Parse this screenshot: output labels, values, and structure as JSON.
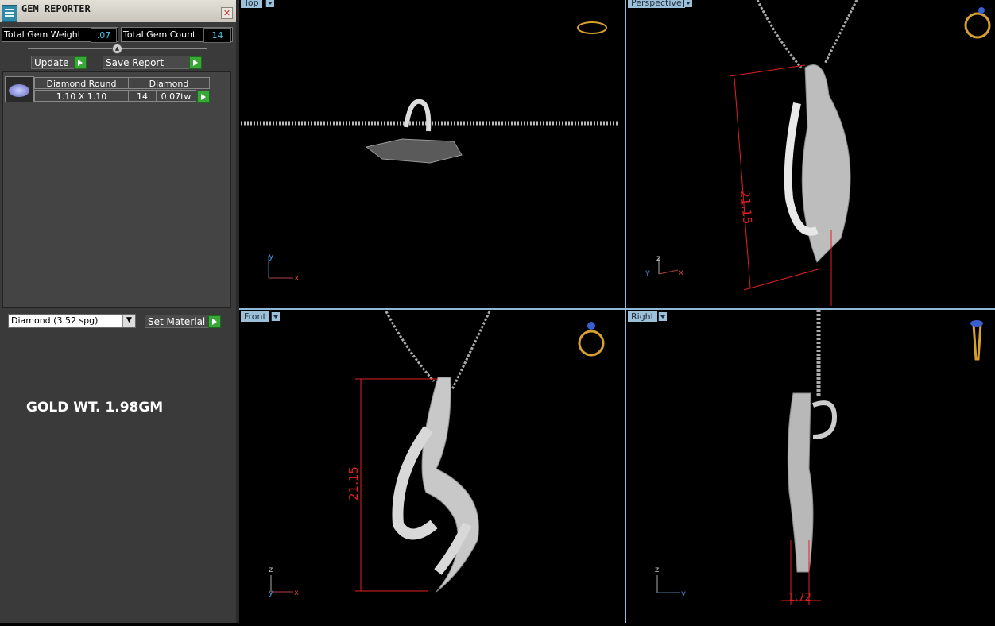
{
  "gem_reporter": {
    "title": "GEM REPORTER",
    "close_glyph": "✕",
    "total_weight_label": "Total Gem Weight",
    "total_weight_value": ".07",
    "total_count_label": "Total Gem Count",
    "total_count_value": "14",
    "update_label": "Update",
    "save_report_label": "Save Report",
    "table": {
      "shape": "Diamond Round",
      "size": "1.10 X 1.10",
      "material": "Diamond",
      "count": "14",
      "weight": "0.07tw"
    },
    "material_select": "Diamond      (3.52 spg)",
    "set_material_label": "Set Material",
    "gold_weight": "GOLD WT. 1.98GM"
  },
  "viewports": {
    "top": {
      "label": "Top"
    },
    "perspective": {
      "label": "Perspective",
      "dimension": "21.15"
    },
    "front": {
      "label": "Front",
      "dimension": "21.15"
    },
    "right": {
      "label": "Right",
      "dimension": "1.72"
    }
  },
  "axes": {
    "x": "x",
    "y": "y",
    "z": "z"
  },
  "colors": {
    "panel": "#3a3a3a",
    "viewport_bg": "#000000",
    "accent": "#8fb9d6",
    "dimension": "#e02020",
    "metal": "#c8c8c8"
  }
}
